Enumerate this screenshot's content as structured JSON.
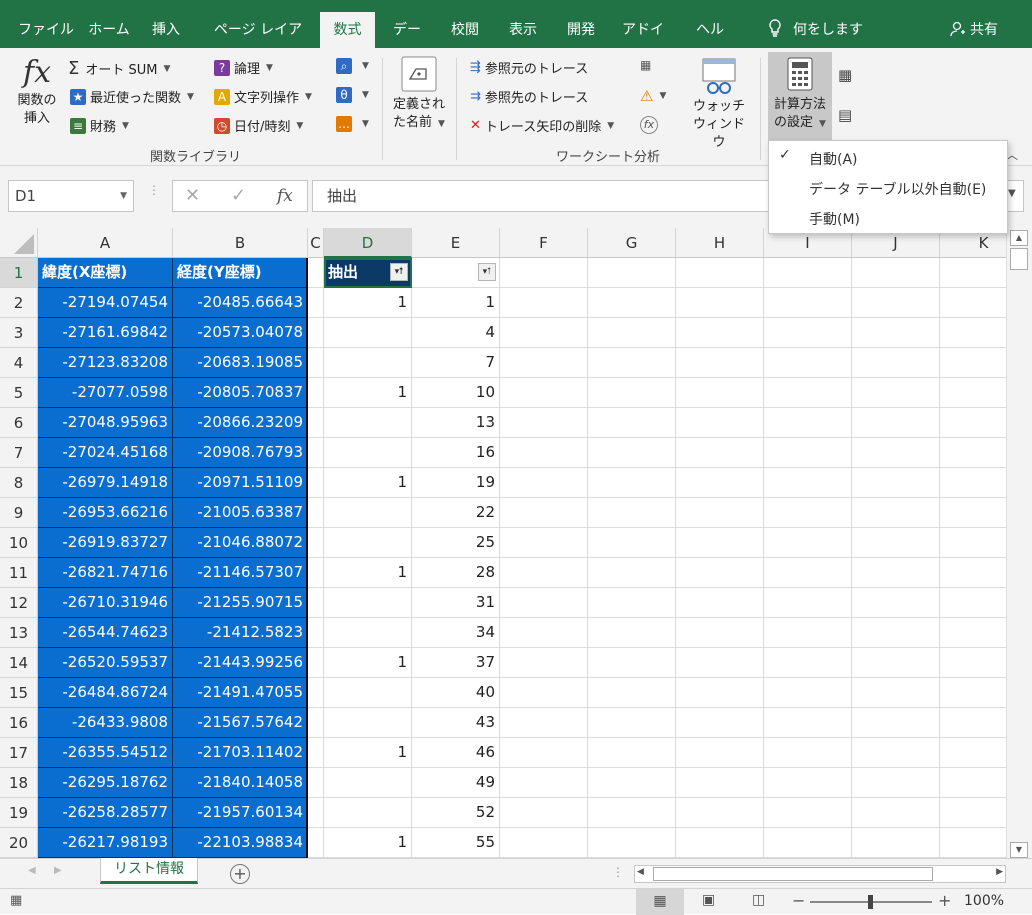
{
  "tabs": [
    "ファイル",
    "ホーム",
    "挿入",
    "ページ レイアウト",
    "数式",
    "データ",
    "校閲",
    "表示",
    "開発",
    "アドイン",
    "ヘルプ"
  ],
  "active_tab": "数式",
  "tell_me": "何をしますか",
  "share": "共有",
  "ribbon": {
    "insert_function": [
      "関数の",
      "挿入"
    ],
    "autosum": "オート SUM",
    "recent": "最近使った関数",
    "financial": "財務",
    "logical": "論理",
    "text": "文字列操作",
    "datetime": "日付/時刻",
    "define_name": [
      "定義され",
      "た名前"
    ],
    "group_function_library": "関数ライブラリ",
    "trace_precedents": "参照元のトレース",
    "trace_dependents": "参照先のトレース",
    "remove_arrows": "トレース矢印の削除",
    "watch_window": [
      "ウォッチ",
      "ウィンドウ"
    ],
    "group_formula_auditing": "ワークシート分析",
    "calc_options": [
      "計算方法",
      "の設定"
    ]
  },
  "calc_menu": {
    "items": [
      "自動(A)",
      "データ テーブル以外自動(E)",
      "手動(M)"
    ],
    "checked": "自動(A)"
  },
  "formula_bar": {
    "namebox": "D1",
    "formula": "抽出",
    "fx": "fx"
  },
  "columns": [
    "A",
    "B",
    "C",
    "D",
    "E",
    "F",
    "G",
    "H",
    "I",
    "J",
    "K"
  ],
  "selected_column": "D",
  "header_row": {
    "A": "緯度(X座標)",
    "B": "経度(Y座標)",
    "D": "抽出"
  },
  "rows": [
    {
      "n": "2",
      "A": "-27194.07454",
      "B": "-20485.66643",
      "D": "1",
      "E": "1"
    },
    {
      "n": "3",
      "A": "-27161.69842",
      "B": "-20573.04078",
      "D": "",
      "E": "4"
    },
    {
      "n": "4",
      "A": "-27123.83208",
      "B": "-20683.19085",
      "D": "",
      "E": "7"
    },
    {
      "n": "5",
      "A": "-27077.0598",
      "B": "-20805.70837",
      "D": "1",
      "E": "10"
    },
    {
      "n": "6",
      "A": "-27048.95963",
      "B": "-20866.23209",
      "D": "",
      "E": "13"
    },
    {
      "n": "7",
      "A": "-27024.45168",
      "B": "-20908.76793",
      "D": "",
      "E": "16"
    },
    {
      "n": "8",
      "A": "-26979.14918",
      "B": "-20971.51109",
      "D": "1",
      "E": "19"
    },
    {
      "n": "9",
      "A": "-26953.66216",
      "B": "-21005.63387",
      "D": "",
      "E": "22"
    },
    {
      "n": "10",
      "A": "-26919.83727",
      "B": "-21046.88072",
      "D": "",
      "E": "25"
    },
    {
      "n": "11",
      "A": "-26821.74716",
      "B": "-21146.57307",
      "D": "1",
      "E": "28"
    },
    {
      "n": "12",
      "A": "-26710.31946",
      "B": "-21255.90715",
      "D": "",
      "E": "31"
    },
    {
      "n": "13",
      "A": "-26544.74623",
      "B": "-21412.5823",
      "D": "",
      "E": "34"
    },
    {
      "n": "14",
      "A": "-26520.59537",
      "B": "-21443.99256",
      "D": "1",
      "E": "37"
    },
    {
      "n": "15",
      "A": "-26484.86724",
      "B": "-21491.47055",
      "D": "",
      "E": "40"
    },
    {
      "n": "16",
      "A": "-26433.9808",
      "B": "-21567.57642",
      "D": "",
      "E": "43"
    },
    {
      "n": "17",
      "A": "-26355.54512",
      "B": "-21703.11402",
      "D": "1",
      "E": "46"
    },
    {
      "n": "18",
      "A": "-26295.18762",
      "B": "-21840.14058",
      "D": "",
      "E": "49"
    },
    {
      "n": "19",
      "A": "-26258.28577",
      "B": "-21957.60134",
      "D": "",
      "E": "52"
    },
    {
      "n": "20",
      "A": "-26217.98193",
      "B": "-22103.98834",
      "D": "1",
      "E": "55"
    }
  ],
  "sheet_tab": "リスト情報",
  "zoom": "100%",
  "colors": {
    "excel_green": "#217346",
    "selection_blue": "#0a6ed1",
    "header_dark": "#0b3a66"
  }
}
